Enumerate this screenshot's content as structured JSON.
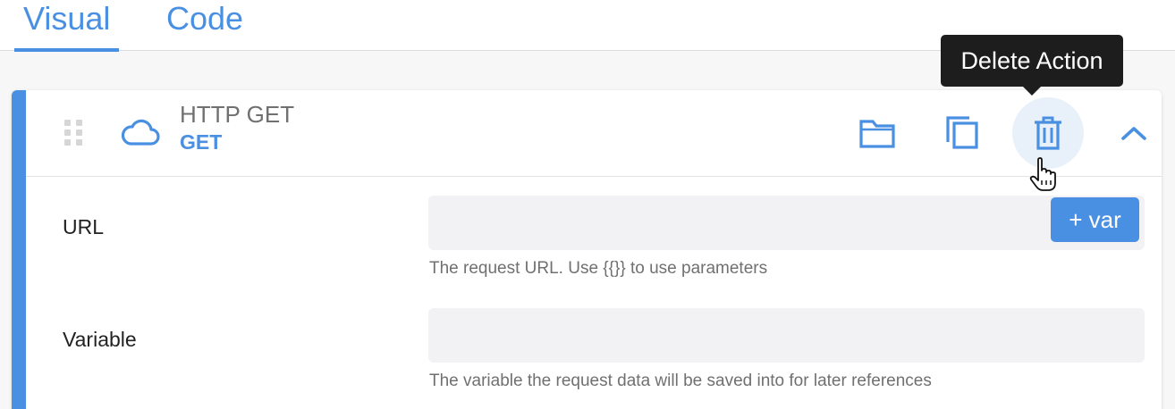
{
  "tabs": [
    {
      "label": "Visual",
      "active": true
    },
    {
      "label": "Code",
      "active": false
    }
  ],
  "action": {
    "title": "HTTP GET",
    "method": "GET",
    "icon": "cloud-icon"
  },
  "toolbar": {
    "folder_icon": "folder-icon",
    "copy_icon": "copy-icon",
    "delete_icon": "trash-icon",
    "collapse_icon": "chevron-up-icon"
  },
  "tooltip": {
    "text": "Delete Action"
  },
  "fields": {
    "url": {
      "label": "URL",
      "value": "",
      "help": "The request URL. Use {{}} to use parameters",
      "var_button": "+ var"
    },
    "variable": {
      "label": "Variable",
      "value": "",
      "help": "The variable the request data will be saved into for later references"
    }
  },
  "colors": {
    "accent": "#4a90e2",
    "tooltip_bg": "#1d1d1d",
    "input_bg": "#f2f2f4"
  }
}
